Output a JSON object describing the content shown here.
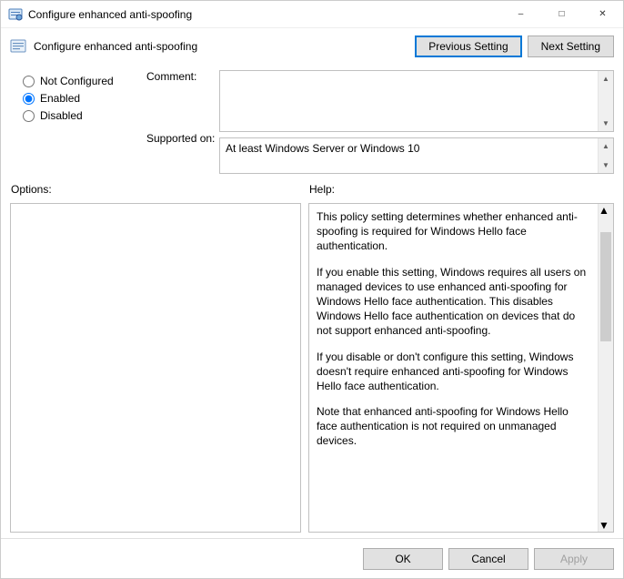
{
  "window": {
    "title": "Configure enhanced anti-spoofing"
  },
  "header": {
    "title": "Configure enhanced anti-spoofing",
    "prev_label": "Previous Setting",
    "next_label": "Next Setting"
  },
  "state": {
    "not_configured_label": "Not Configured",
    "enabled_label": "Enabled",
    "disabled_label": "Disabled",
    "selected": "Enabled"
  },
  "labels": {
    "comment": "Comment:",
    "supported": "Supported on:",
    "options": "Options:",
    "help": "Help:"
  },
  "fields": {
    "comment": "",
    "supported": "At least Windows Server or Windows 10"
  },
  "help": {
    "p1": "This policy setting determines whether enhanced anti-spoofing is required for Windows Hello face authentication.",
    "p2": "If you enable this setting, Windows requires all users on managed devices to use enhanced anti-spoofing for Windows Hello face authentication. This disables Windows Hello face authentication on devices that do not support enhanced anti-spoofing.",
    "p3": "If you disable or don't configure this setting, Windows doesn't require enhanced anti-spoofing for Windows Hello face authentication.",
    "p4": "Note that enhanced anti-spoofing for Windows Hello face authentication is not required on unmanaged devices."
  },
  "footer": {
    "ok": "OK",
    "cancel": "Cancel",
    "apply": "Apply"
  }
}
